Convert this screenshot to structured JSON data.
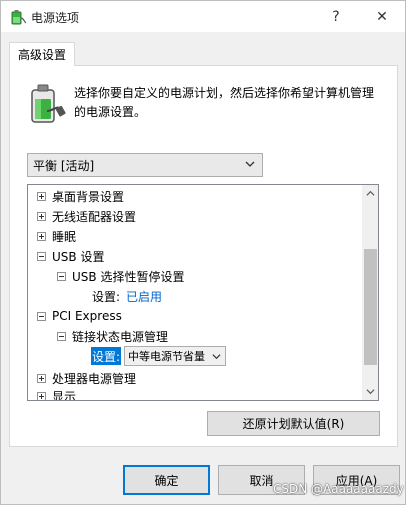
{
  "window": {
    "title": "电源选项",
    "help": "?",
    "close": "✕"
  },
  "tabs": [
    {
      "label": "高级设置"
    }
  ],
  "description": "选择你要自定义的电源计划，然后选择你希望计算机管理的电源设置。",
  "plan_select": {
    "value": "平衡 [活动]"
  },
  "tree": {
    "items": [
      {
        "label": "桌面背景设置",
        "expander": "plus"
      },
      {
        "label": "无线适配器设置",
        "expander": "plus"
      },
      {
        "label": "睡眠",
        "expander": "plus"
      },
      {
        "label": "USB 设置",
        "expander": "minus"
      },
      {
        "label": "USB 选择性暂停设置",
        "expander": "minus"
      },
      {
        "label": "设置:",
        "value": "已启用"
      },
      {
        "label": "PCI Express",
        "expander": "minus"
      },
      {
        "label": "链接状态电源管理",
        "expander": "minus"
      },
      {
        "label": "设置:",
        "value": "中等电源节省量"
      },
      {
        "label": "处理器电源管理",
        "expander": "plus"
      },
      {
        "label": "显示",
        "expander": "plus"
      }
    ]
  },
  "buttons": {
    "restore": "还原计划默认值(R)",
    "ok": "确定",
    "cancel": "取消",
    "apply": "应用(A)"
  },
  "watermark": "CSDN @Aaaaaaaazdy",
  "colors": {
    "selection": "#0078d7",
    "link": "#0066cc",
    "battery_green": "#3cb043"
  }
}
